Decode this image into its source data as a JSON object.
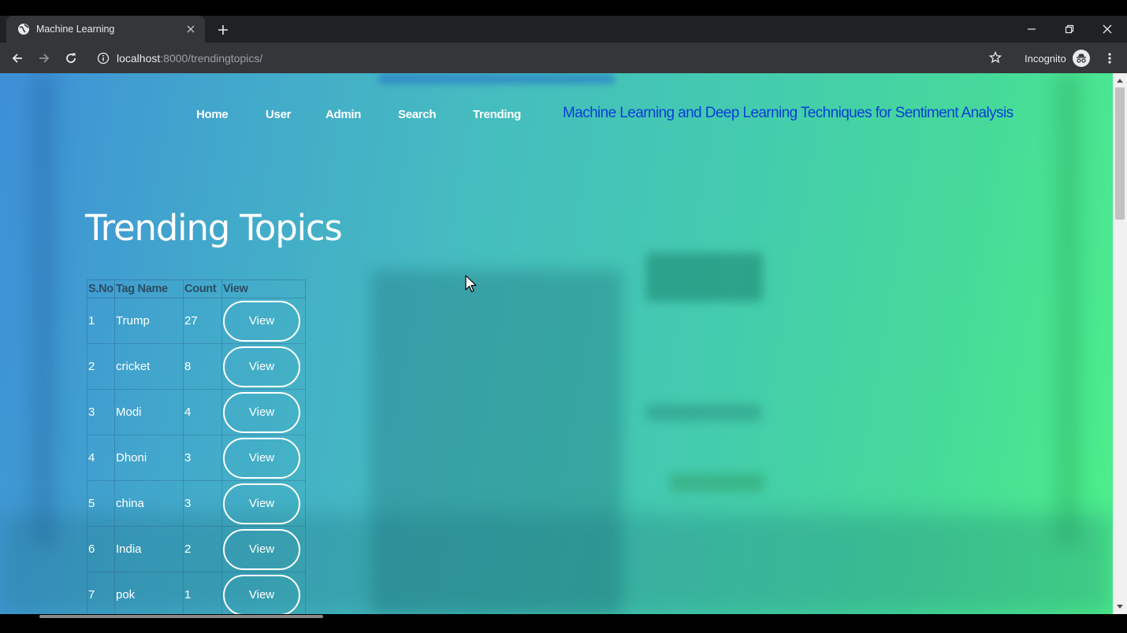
{
  "browser": {
    "tab_title": "Machine Learning",
    "url_host": "localhost",
    "url_path": ":8000/trendingtopics/",
    "profile_label": "Incognito"
  },
  "nav": {
    "items": [
      "Home",
      "User",
      "Admin",
      "Search",
      "Trending"
    ],
    "site_title": "Machine Learning and Deep Learning Techniques for Sentiment Analysis"
  },
  "page": {
    "heading": "Trending Topics"
  },
  "table": {
    "headers": [
      "S.No",
      "Tag Name",
      "Count",
      "View"
    ],
    "rows": [
      {
        "sno": "1",
        "tag": "Trump",
        "count": "27",
        "action": "View"
      },
      {
        "sno": "2",
        "tag": "cricket",
        "count": "8",
        "action": "View"
      },
      {
        "sno": "3",
        "tag": "Modi",
        "count": "4",
        "action": "View"
      },
      {
        "sno": "4",
        "tag": "Dhoni",
        "count": "3",
        "action": "View"
      },
      {
        "sno": "5",
        "tag": "china",
        "count": "3",
        "action": "View"
      },
      {
        "sno": "6",
        "tag": "India",
        "count": "2",
        "action": "View"
      },
      {
        "sno": "7",
        "tag": "pok",
        "count": "1",
        "action": "View"
      }
    ]
  },
  "colors": {
    "gradient_start": "#3d8fd8",
    "gradient_end": "#4df08a",
    "site_title": "#0a3fd6",
    "table_header": "#2c4c63"
  }
}
